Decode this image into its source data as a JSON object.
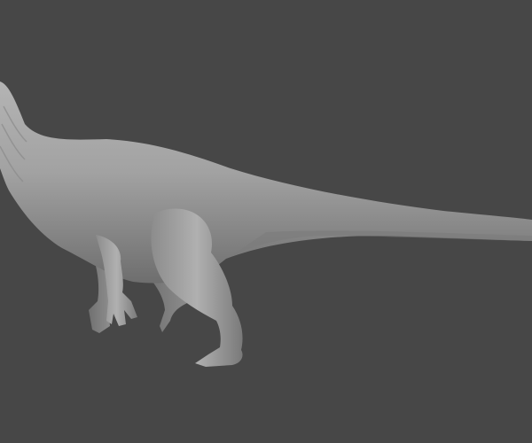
{
  "scene": {
    "subject": "dinosaur-sculpt",
    "background_color": "#474747",
    "model_light": "#c8c8c8",
    "model_mid": "#9a9a9a",
    "model_dark": "#5e5e5e"
  }
}
